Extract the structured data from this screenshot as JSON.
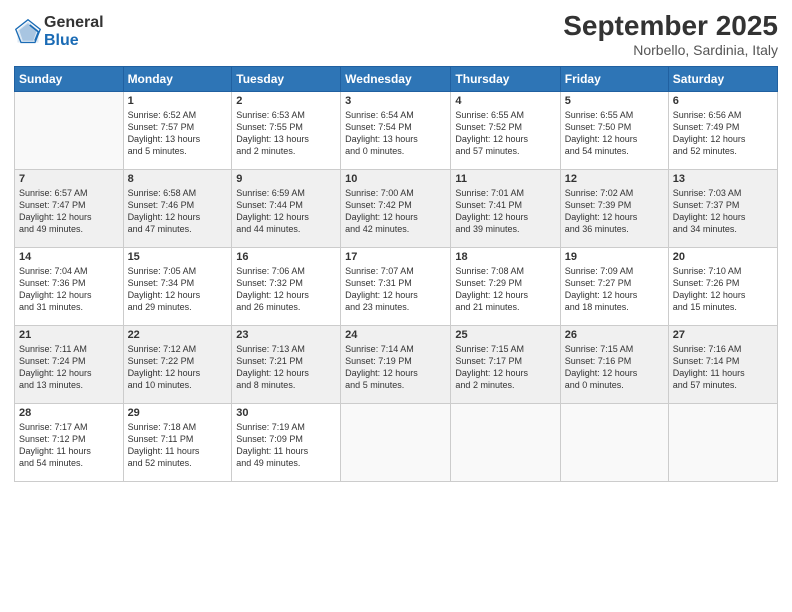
{
  "logo": {
    "general": "General",
    "blue": "Blue"
  },
  "header": {
    "month": "September 2025",
    "location": "Norbello, Sardinia, Italy"
  },
  "weekdays": [
    "Sunday",
    "Monday",
    "Tuesday",
    "Wednesday",
    "Thursday",
    "Friday",
    "Saturday"
  ],
  "weeks": [
    [
      {
        "day": "",
        "info": ""
      },
      {
        "day": "1",
        "info": "Sunrise: 6:52 AM\nSunset: 7:57 PM\nDaylight: 13 hours\nand 5 minutes."
      },
      {
        "day": "2",
        "info": "Sunrise: 6:53 AM\nSunset: 7:55 PM\nDaylight: 13 hours\nand 2 minutes."
      },
      {
        "day": "3",
        "info": "Sunrise: 6:54 AM\nSunset: 7:54 PM\nDaylight: 13 hours\nand 0 minutes."
      },
      {
        "day": "4",
        "info": "Sunrise: 6:55 AM\nSunset: 7:52 PM\nDaylight: 12 hours\nand 57 minutes."
      },
      {
        "day": "5",
        "info": "Sunrise: 6:55 AM\nSunset: 7:50 PM\nDaylight: 12 hours\nand 54 minutes."
      },
      {
        "day": "6",
        "info": "Sunrise: 6:56 AM\nSunset: 7:49 PM\nDaylight: 12 hours\nand 52 minutes."
      }
    ],
    [
      {
        "day": "7",
        "info": "Sunrise: 6:57 AM\nSunset: 7:47 PM\nDaylight: 12 hours\nand 49 minutes."
      },
      {
        "day": "8",
        "info": "Sunrise: 6:58 AM\nSunset: 7:46 PM\nDaylight: 12 hours\nand 47 minutes."
      },
      {
        "day": "9",
        "info": "Sunrise: 6:59 AM\nSunset: 7:44 PM\nDaylight: 12 hours\nand 44 minutes."
      },
      {
        "day": "10",
        "info": "Sunrise: 7:00 AM\nSunset: 7:42 PM\nDaylight: 12 hours\nand 42 minutes."
      },
      {
        "day": "11",
        "info": "Sunrise: 7:01 AM\nSunset: 7:41 PM\nDaylight: 12 hours\nand 39 minutes."
      },
      {
        "day": "12",
        "info": "Sunrise: 7:02 AM\nSunset: 7:39 PM\nDaylight: 12 hours\nand 36 minutes."
      },
      {
        "day": "13",
        "info": "Sunrise: 7:03 AM\nSunset: 7:37 PM\nDaylight: 12 hours\nand 34 minutes."
      }
    ],
    [
      {
        "day": "14",
        "info": "Sunrise: 7:04 AM\nSunset: 7:36 PM\nDaylight: 12 hours\nand 31 minutes."
      },
      {
        "day": "15",
        "info": "Sunrise: 7:05 AM\nSunset: 7:34 PM\nDaylight: 12 hours\nand 29 minutes."
      },
      {
        "day": "16",
        "info": "Sunrise: 7:06 AM\nSunset: 7:32 PM\nDaylight: 12 hours\nand 26 minutes."
      },
      {
        "day": "17",
        "info": "Sunrise: 7:07 AM\nSunset: 7:31 PM\nDaylight: 12 hours\nand 23 minutes."
      },
      {
        "day": "18",
        "info": "Sunrise: 7:08 AM\nSunset: 7:29 PM\nDaylight: 12 hours\nand 21 minutes."
      },
      {
        "day": "19",
        "info": "Sunrise: 7:09 AM\nSunset: 7:27 PM\nDaylight: 12 hours\nand 18 minutes."
      },
      {
        "day": "20",
        "info": "Sunrise: 7:10 AM\nSunset: 7:26 PM\nDaylight: 12 hours\nand 15 minutes."
      }
    ],
    [
      {
        "day": "21",
        "info": "Sunrise: 7:11 AM\nSunset: 7:24 PM\nDaylight: 12 hours\nand 13 minutes."
      },
      {
        "day": "22",
        "info": "Sunrise: 7:12 AM\nSunset: 7:22 PM\nDaylight: 12 hours\nand 10 minutes."
      },
      {
        "day": "23",
        "info": "Sunrise: 7:13 AM\nSunset: 7:21 PM\nDaylight: 12 hours\nand 8 minutes."
      },
      {
        "day": "24",
        "info": "Sunrise: 7:14 AM\nSunset: 7:19 PM\nDaylight: 12 hours\nand 5 minutes."
      },
      {
        "day": "25",
        "info": "Sunrise: 7:15 AM\nSunset: 7:17 PM\nDaylight: 12 hours\nand 2 minutes."
      },
      {
        "day": "26",
        "info": "Sunrise: 7:15 AM\nSunset: 7:16 PM\nDaylight: 12 hours\nand 0 minutes."
      },
      {
        "day": "27",
        "info": "Sunrise: 7:16 AM\nSunset: 7:14 PM\nDaylight: 11 hours\nand 57 minutes."
      }
    ],
    [
      {
        "day": "28",
        "info": "Sunrise: 7:17 AM\nSunset: 7:12 PM\nDaylight: 11 hours\nand 54 minutes."
      },
      {
        "day": "29",
        "info": "Sunrise: 7:18 AM\nSunset: 7:11 PM\nDaylight: 11 hours\nand 52 minutes."
      },
      {
        "day": "30",
        "info": "Sunrise: 7:19 AM\nSunset: 7:09 PM\nDaylight: 11 hours\nand 49 minutes."
      },
      {
        "day": "",
        "info": ""
      },
      {
        "day": "",
        "info": ""
      },
      {
        "day": "",
        "info": ""
      },
      {
        "day": "",
        "info": ""
      }
    ]
  ]
}
